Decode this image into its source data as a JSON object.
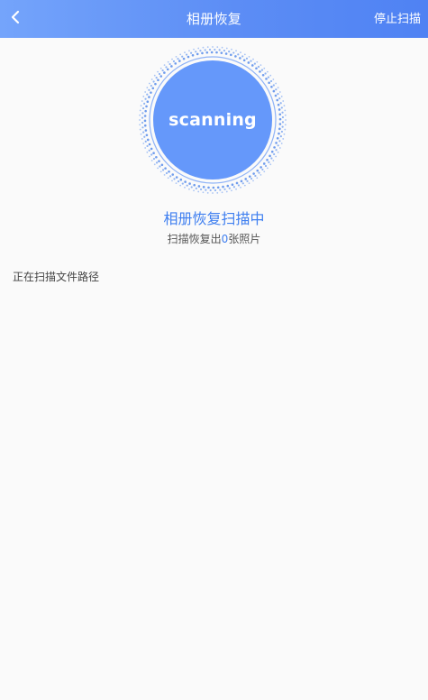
{
  "header": {
    "title": "相册恢复",
    "stop_label": "停止扫描",
    "back_icon": "chevron-left-icon"
  },
  "scan": {
    "label": "scanning",
    "status_title": "相册恢复扫描中",
    "count_prefix": "扫描恢复出",
    "count_value": "0",
    "count_suffix": "张照片",
    "current_path_label": "正在扫描文件路径"
  },
  "colors": {
    "header_gradient_start": "#74a4fb",
    "header_gradient_end": "#4f82f3",
    "accent": "#3f7ff0",
    "circle_fill": "#6598fa",
    "background": "#fafafa"
  }
}
